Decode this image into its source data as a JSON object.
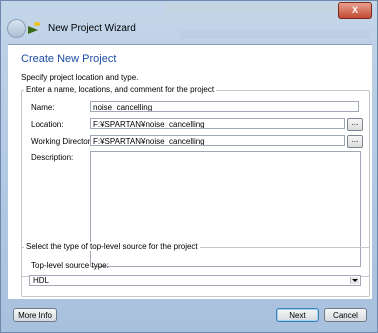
{
  "window": {
    "title": "New Project Wizard",
    "close_label": "X"
  },
  "page": {
    "header": "Create New Project",
    "subtitle": "Specify project location and type."
  },
  "project_group": {
    "legend": "Enter a name, locations, and comment for the project",
    "name_label": "Name:",
    "name_value": "noise_cancelling",
    "location_label": "Location:",
    "location_value": "F:¥SPARTAN¥noise_cancelling",
    "workdir_label": "Working Directory:",
    "workdir_value": "F:¥SPARTAN¥noise_cancelling",
    "description_label": "Description:",
    "browse_label": "..."
  },
  "source_group": {
    "legend": "Select the type of top-level source for the project",
    "type_label": "Top-level source type:",
    "type_value": "HDL"
  },
  "buttons": {
    "more_info": "More Info",
    "next": "Next",
    "cancel": "Cancel"
  }
}
